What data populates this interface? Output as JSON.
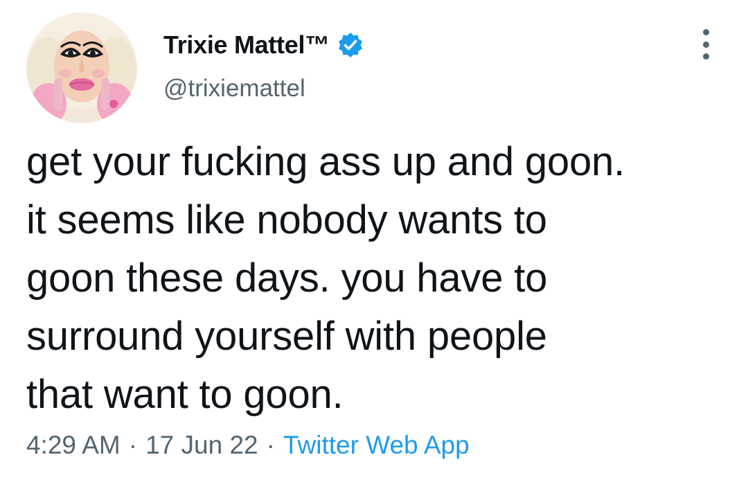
{
  "author": {
    "display_name": "Trixie Mattel™",
    "handle": "@trixiemattel",
    "verified": true,
    "verified_color": "#1d9bf0"
  },
  "tweet": {
    "lines": [
      "get your fucking ass up and goon.",
      "it seems like nobody wants to",
      "goon these days. you have to",
      "surround yourself with people",
      "that want to goon."
    ]
  },
  "meta": {
    "time": "4:29 AM",
    "separator": "·",
    "date": "17 Jun 22",
    "source": "Twitter Web App"
  },
  "icons": {
    "more": "more-vertical-icon",
    "verified": "verified-badge-icon"
  },
  "colors": {
    "text": "#0f1419",
    "secondary": "#536471",
    "link": "#1d9bf0"
  }
}
